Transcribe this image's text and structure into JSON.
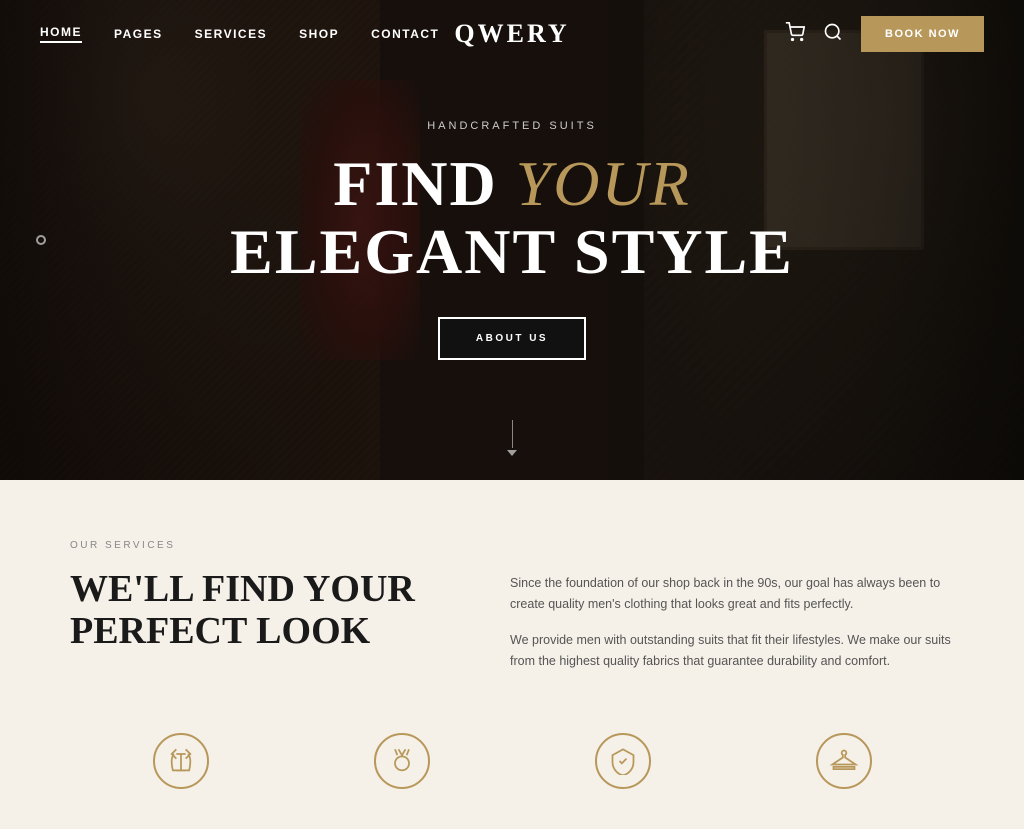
{
  "nav": {
    "logo": "QWERY",
    "items": [
      {
        "label": "HOME",
        "active": true
      },
      {
        "label": "PAGES",
        "active": false
      },
      {
        "label": "SERVICES",
        "active": false
      },
      {
        "label": "SHOP",
        "active": false
      },
      {
        "label": "CONTACT",
        "active": false
      }
    ],
    "book_now": "BOOK NOW"
  },
  "hero": {
    "subtitle": "HANDCRAFTED SUITS",
    "title_line1_before": "FIND ",
    "title_line1_italic": "YOUR",
    "title_line2": "ELEGANT STYLE",
    "cta": "ABOUT US"
  },
  "services": {
    "section_label": "OUR SERVICES",
    "heading_line1": "WE'LL FIND YOUR",
    "heading_line2": "PERFECT LOOK",
    "para1": "Since the foundation of our shop back in the 90s, our goal has always been to create quality men's clothing that looks great and fits perfectly.",
    "para2": "We provide men with outstanding suits that fit their lifestyles. We make our suits from the highest quality fabrics that guarantee durability and comfort.",
    "icons": [
      {
        "name": "suit-icon"
      },
      {
        "name": "medal-icon"
      },
      {
        "name": "shield-icon"
      },
      {
        "name": "hanger-icon"
      }
    ]
  },
  "colors": {
    "gold": "#b8985a",
    "dark": "#1a1a1a",
    "bg_light": "#f5f0e8"
  }
}
